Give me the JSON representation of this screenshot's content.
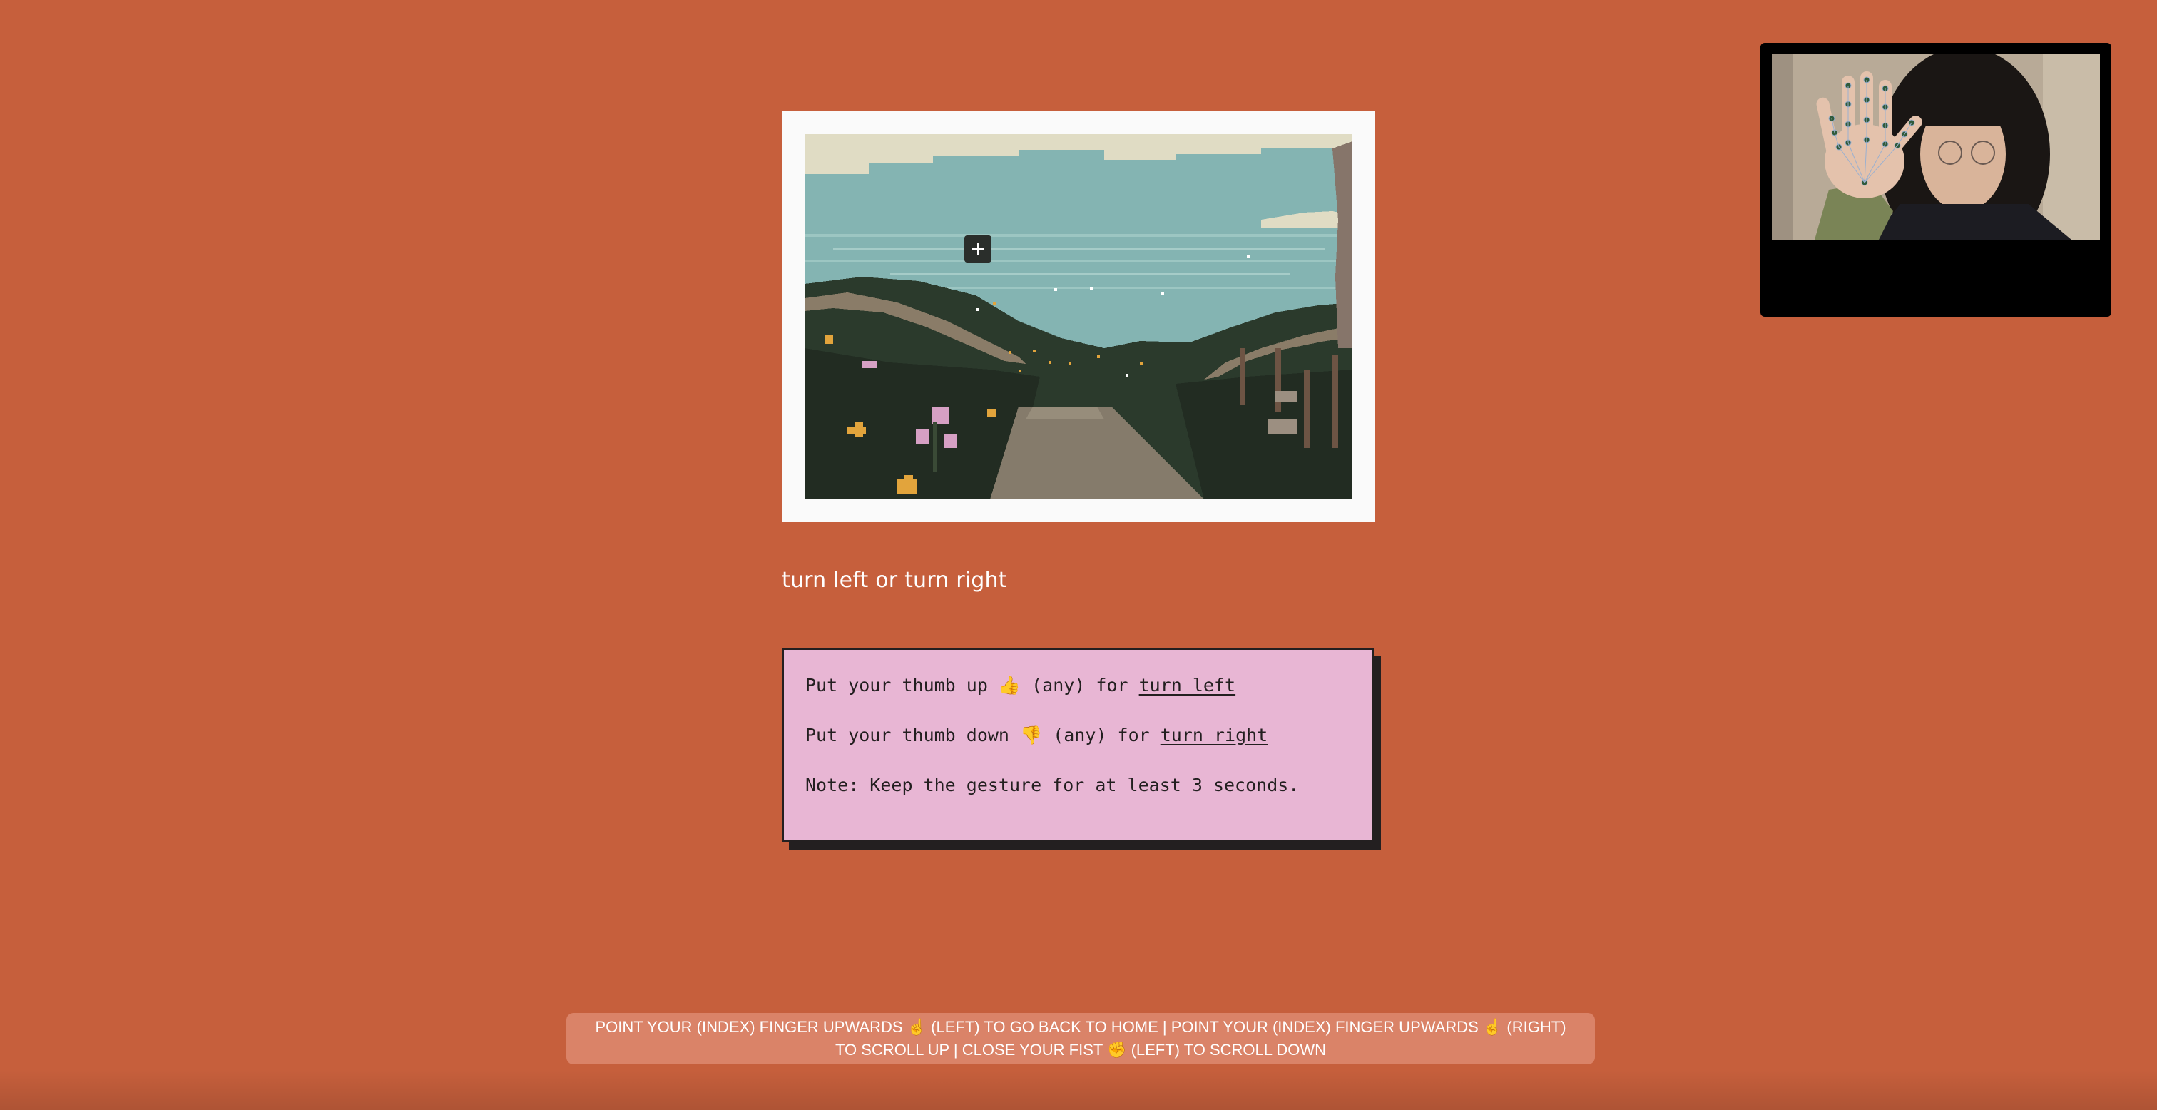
{
  "scene": {
    "image_alt": "pixel-art landscape with path leading to the sea"
  },
  "question": {
    "text": "turn left or turn right"
  },
  "instructions": {
    "line1_prefix": "Put your thumb up 👍 (any) for ",
    "line1_link": "turn left",
    "line2_prefix": "Put your thumb down 👎 (any) for ",
    "line2_link": "turn right",
    "note": "Note: Keep the gesture for at least 3 seconds."
  },
  "help_bar": {
    "text": "POINT YOUR (INDEX) FINGER UPWARDS ☝️ (LEFT) TO GO BACK TO HOME | POINT YOUR (INDEX) FINGER UPWARDS ☝️ (RIGHT) TO SCROLL UP | CLOSE YOUR FIST ✊ (LEFT) TO SCROLL DOWN"
  },
  "colors": {
    "background": "#c65f3c",
    "instruction_box": "#e8b6d4",
    "instruction_border": "#231f20",
    "card": "#fafafa"
  },
  "icons": {
    "plus": "plus-icon"
  }
}
